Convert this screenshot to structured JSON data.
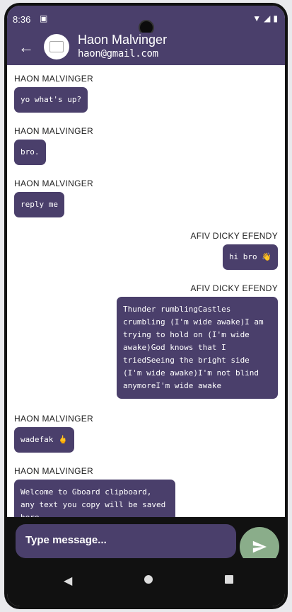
{
  "status": {
    "time": "8:36",
    "sim_icon": "sim-icon"
  },
  "header": {
    "back_icon": "back-arrow-icon",
    "name": "Haon Malvinger",
    "email": "haon@gmail.com"
  },
  "messages": [
    {
      "sender": "HAON MALVINGER",
      "text": "yo what's up?",
      "side": "left"
    },
    {
      "sender": "HAON MALVINGER",
      "text": "bro.",
      "side": "left"
    },
    {
      "sender": "HAON MALVINGER",
      "text": "reply me",
      "side": "left"
    },
    {
      "sender": "AFIV DICKY EFENDY",
      "text": "hi bro 👋",
      "side": "right"
    },
    {
      "sender": "AFIV DICKY EFENDY",
      "text": "Thunder rumblingCastles crumbling (I'm wide awake)I am trying to hold on (I'm wide awake)God knows that I triedSeeing the bright side (I'm wide awake)I'm not blind anymoreI'm wide awake",
      "side": "right"
    },
    {
      "sender": "HAON MALVINGER",
      "text": "wadefak 🖕",
      "side": "left"
    },
    {
      "sender": "HAON MALVINGER",
      "text": "Welcome to Gboard clipboard, any text you copy will be saved here.",
      "side": "left"
    }
  ],
  "composer": {
    "placeholder": "Type message...",
    "send_icon": "send-icon"
  },
  "colors": {
    "primary": "#4a3f6b",
    "send_button": "#8aad8a"
  }
}
